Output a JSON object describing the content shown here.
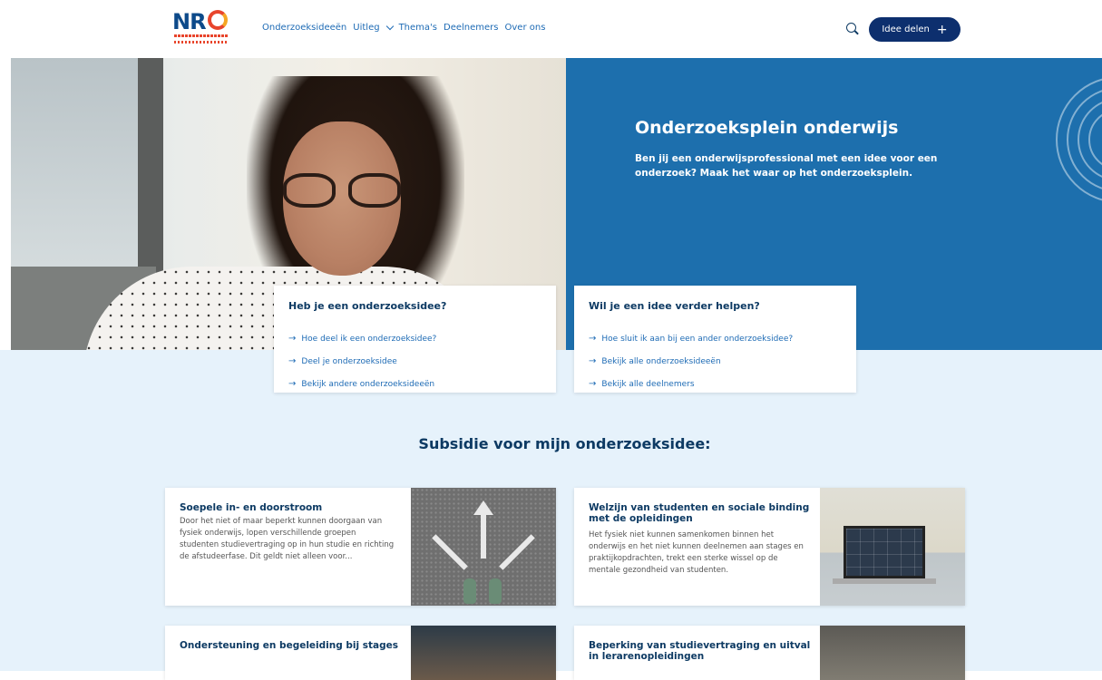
{
  "header": {
    "logo_text": "NR",
    "nav": [
      "Onderzoeksideeën",
      "Uitleg",
      "Thema's",
      "Deelnemers",
      "Over ons"
    ],
    "cta_label": "Idee delen",
    "cta_icon": "plus-icon"
  },
  "hero": {
    "title": "Onderzoeksplein onderwijs",
    "text": "Ben jij een onderwijsprofessional met een idee voor een onderzoek? Maak het waar op het onderzoeksplein.",
    "panel_color": "#1d6fad"
  },
  "idea_card": {
    "title": "Heb je een onderzoeksidee?",
    "links": [
      "Hoe deel ik een onderzoeksidee?",
      "Deel je onderzoeksidee",
      "Bekijk andere onderzoeksideeën"
    ]
  },
  "help_card": {
    "title": "Wil je een idee verder helpen?",
    "links": [
      "Hoe sluit ik aan bij een ander onderzoeksidee?",
      "Bekijk alle onderzoeksideeën",
      "Bekijk alle deelnemers"
    ]
  },
  "subsidy": {
    "title": "Subsidie voor mijn onderzoeksidee:",
    "cards": [
      {
        "title": "Soepele in- en doorstroom",
        "text": "Door het niet of maar beperkt kunnen doorgaan van fysiek onderwijs, lopen verschillende groepen studenten studievertraging op in hun studie en richting de afstudeerfase. Dit geldt niet alleen voor..."
      },
      {
        "title": "Welzijn van studenten en sociale binding met de opleidingen",
        "text": "Het fysiek niet kunnen samenkomen binnen het onderwijs en het niet kunnen deelnemen aan stages en praktijkopdrachten, trekt een sterke wissel op de mentale gezondheid van studenten."
      },
      {
        "title": "Ondersteuning en begeleiding bij stages",
        "text": ""
      },
      {
        "title": "Beperking van studievertraging en uitval in lerarenopleidingen",
        "text": ""
      }
    ]
  }
}
